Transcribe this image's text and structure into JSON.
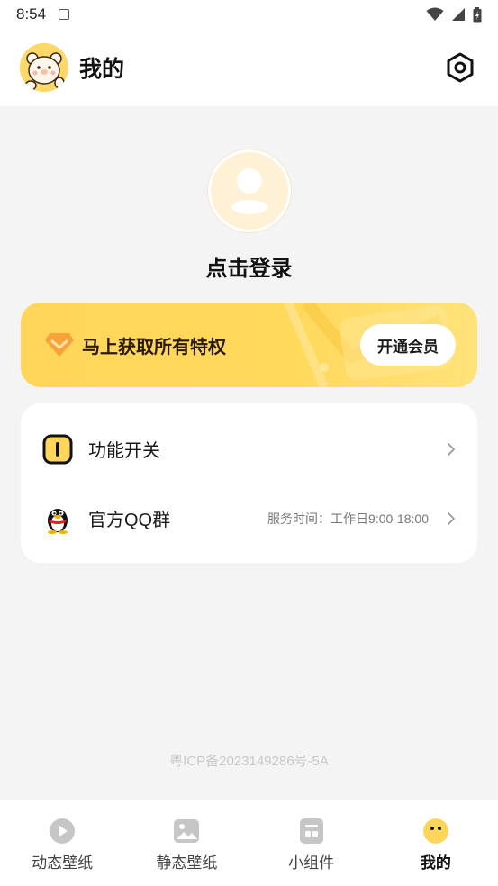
{
  "status_bar": {
    "time": "8:54"
  },
  "header": {
    "title": "我的"
  },
  "profile": {
    "login_text": "点击登录"
  },
  "vip_banner": {
    "text": "马上获取所有特权",
    "button_label": "开通会员"
  },
  "menu": {
    "items": [
      {
        "label": "功能开关",
        "extra": ""
      },
      {
        "label": "官方QQ群",
        "extra": "服务时间：工作日9:00-18:00"
      }
    ]
  },
  "footer": {
    "icp": "粤ICP备2023149286号-5A"
  },
  "bottom_nav": {
    "items": [
      {
        "label": "动态壁纸",
        "icon": "play-circle-icon"
      },
      {
        "label": "静态壁纸",
        "icon": "image-icon"
      },
      {
        "label": "小组件",
        "icon": "widget-icon"
      },
      {
        "label": "我的",
        "icon": "face-icon",
        "active": true
      }
    ]
  },
  "colors": {
    "accent": "#ffd65a",
    "background": "#f4f4f4",
    "card": "#ffffff"
  }
}
